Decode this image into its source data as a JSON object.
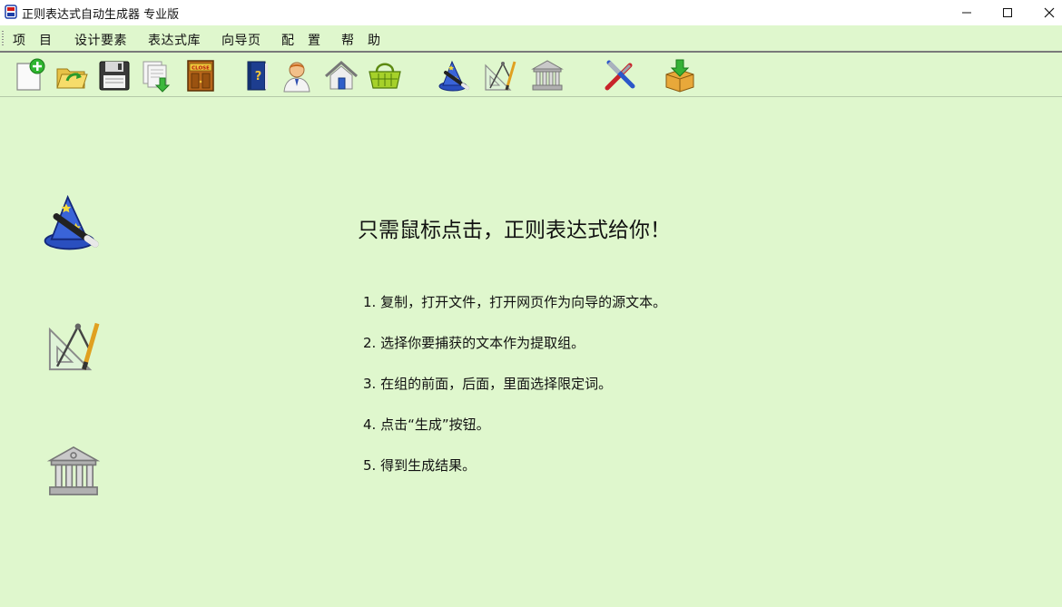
{
  "window": {
    "title": "正则表达式自动生成器 专业版",
    "controls": {
      "minimize": "—",
      "maximize": "☐",
      "close": "✕"
    }
  },
  "menu": {
    "items": [
      {
        "label": "项　目"
      },
      {
        "label": "设计要素"
      },
      {
        "label": "表达式库"
      },
      {
        "label": "向导页"
      },
      {
        "label": "配　置"
      },
      {
        "label": "帮　助"
      }
    ]
  },
  "toolbar": {
    "buttons": [
      {
        "icon": "new-file-icon"
      },
      {
        "icon": "open-folder-icon"
      },
      {
        "icon": "save-disk-icon"
      },
      {
        "icon": "import-pages-icon"
      },
      {
        "icon": "close-door-icon",
        "badge": "CLOSE"
      },
      {
        "icon": "help-book-icon"
      },
      {
        "icon": "user-doctor-icon"
      },
      {
        "icon": "home-icon"
      },
      {
        "icon": "basket-icon"
      },
      {
        "icon": "wizard-hat-icon"
      },
      {
        "icon": "drafting-tools-icon"
      },
      {
        "icon": "library-building-icon"
      },
      {
        "icon": "tools-icon"
      },
      {
        "icon": "download-box-icon"
      }
    ]
  },
  "main": {
    "headline": "只需鼠标点击，正则表达式给你！",
    "steps": [
      "1. 复制，打开文件，打开网页作为向导的源文本。",
      "2. 选择你要捕获的文本作为提取组。",
      "3. 在组的前面，后面，里面选择限定词。",
      "4. 点击“生成”按钮。",
      "5. 得到生成结果。"
    ],
    "side_icons": [
      "wizard-hat-icon",
      "drafting-tools-icon",
      "library-building-icon"
    ]
  },
  "colors": {
    "background": "#dff7cd",
    "titlebar": "#ffffff",
    "accent_green": "#2fb52f"
  }
}
